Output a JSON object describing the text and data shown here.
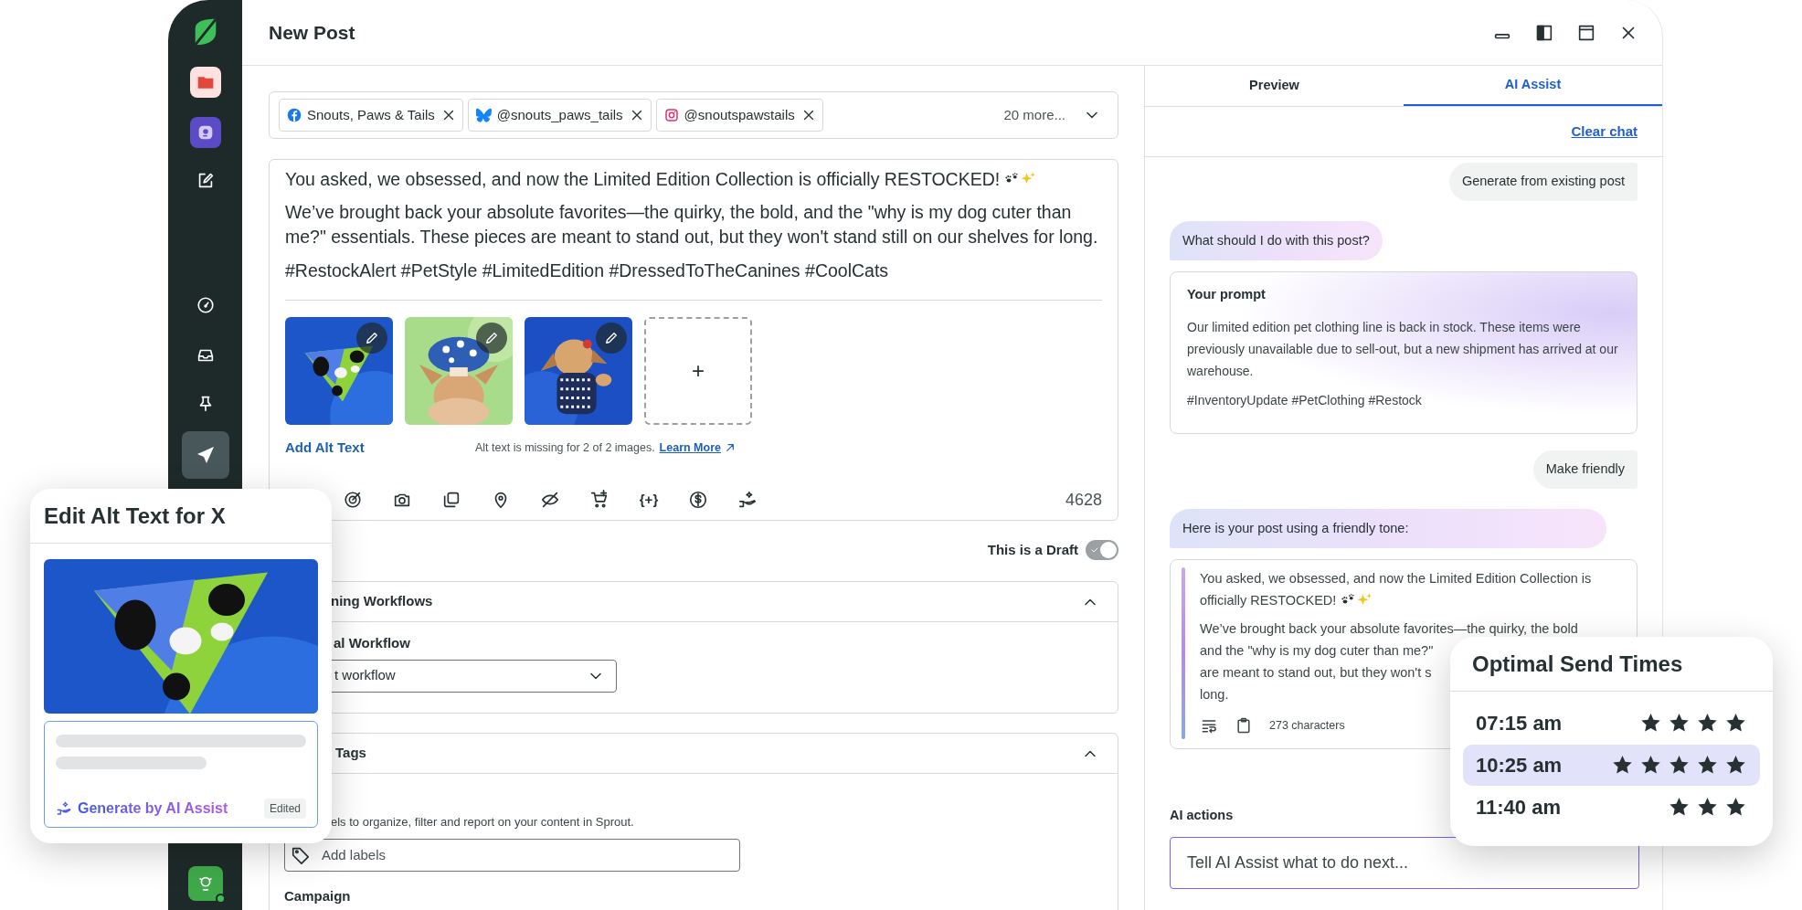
{
  "window": {
    "title": "New Post"
  },
  "sidebar": {
    "items": [
      {
        "kind": "folder",
        "selected": false
      },
      {
        "kind": "bot",
        "selected": false
      },
      {
        "kind": "compose",
        "selected": false
      },
      {
        "kind": "gauge",
        "selected": false
      },
      {
        "kind": "inbox",
        "selected": false
      },
      {
        "kind": "pin",
        "selected": false
      },
      {
        "kind": "send",
        "selected": true
      }
    ]
  },
  "accounts": {
    "chips": [
      {
        "kind": "facebook",
        "label": "Snouts, Paws & Tails"
      },
      {
        "kind": "bluesky",
        "label": "@snouts_paws_tails"
      },
      {
        "kind": "instagram",
        "label": "@snoutspawstails"
      }
    ],
    "more": "20 more..."
  },
  "post": {
    "paragraphs": [
      "You asked, we obsessed, and now the Limited Edition Collection is officially RESTOCKED!",
      "We’ve brought back your absolute favorites—the quirky, the bold, and the \"why is my dog cuter than me?\" essentials. These pieces are meant to stand out, but they won't stand still on our shelves for long.",
      "#RestockAlert #PetStyle #LimitedEdition #DressedToTheCanines #CoolCats"
    ],
    "media": [
      {
        "kind": "picture"
      },
      {
        "kind": "picture"
      },
      {
        "kind": "picture"
      }
    ],
    "add_media": "+",
    "alt_text_link": "Add Alt Text",
    "alt_text_warning": "Alt text is missing for 2 of 2 images.",
    "learn_more": "Learn More",
    "variables": "{+}",
    "character_count": "4628"
  },
  "draft": {
    "label": "This is a Draft",
    "on": true
  },
  "workflows": {
    "title": "ning Workflows",
    "expanded": true,
    "field_label": "al Workflow",
    "select_value": "t workflow"
  },
  "tags": {
    "title": "Tags",
    "expanded": true,
    "hint": "els to organize, filter and report on your content in Sprout.",
    "labels_placeholder": "Add labels",
    "campaign_label": "Campaign"
  },
  "side_panel": {
    "tabs": [
      {
        "label": "Preview",
        "selected": false
      },
      {
        "label": "AI Assist",
        "selected": true
      }
    ],
    "clear_chat": "Clear chat",
    "messages": [
      {
        "kind": "user",
        "text": "Generate from existing post"
      },
      {
        "kind": "assistant",
        "text": "What should I do with this post?"
      },
      {
        "kind": "prompt",
        "title": "Your prompt",
        "paragraphs": [
          "Our limited edition pet clothing line is back in stock. These items were previously unavailable due to sell-out, but a new shipment has arrived at our warehouse.",
          "#InventoryUpdate #PetClothing #Restock"
        ]
      },
      {
        "kind": "user",
        "text": "Make friendly"
      },
      {
        "kind": "assistant",
        "text": "Here is your post using a friendly tone:"
      },
      {
        "kind": "result",
        "first_lines": [
          "You asked, we obsessed, and now the Limited Edition Collection is",
          "officially RESTOCKED!"
        ],
        "lines": [
          "We’ve brought back your absolute favorites—the quirky, the bold",
          "and the \"why is my dog cuter than me?\"",
          "are meant to stand out, but they won't s",
          "long."
        ],
        "character_count": "273 characters"
      }
    ],
    "actions_label": "AI actions",
    "actions_placeholder": "Tell AI Assist what to do next..."
  },
  "alt_text_editor": {
    "title": "Edit Alt Text for X",
    "image": {
      "kind": "picture"
    },
    "generate": "Generate by AI Assist",
    "badge": "Edited"
  },
  "optimal_send_times": {
    "title": "Optimal Send Times",
    "slots": [
      {
        "time": "07:15 am",
        "stars": 4,
        "selected": false
      },
      {
        "time": "10:25 am",
        "stars": 5,
        "selected": true
      },
      {
        "time": "11:40 am",
        "stars": 3,
        "selected": false
      }
    ]
  }
}
